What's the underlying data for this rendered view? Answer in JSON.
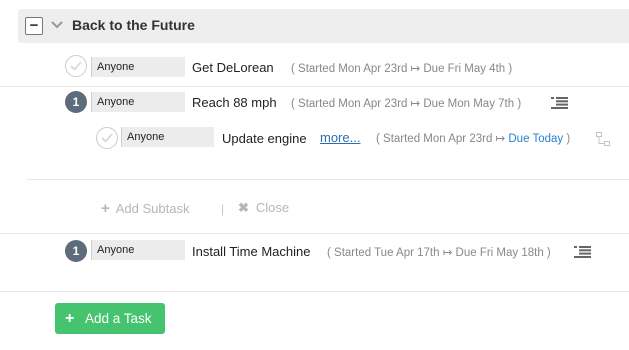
{
  "group": {
    "collapse_symbol": "−",
    "chevron_icon": "chevron-down-icon",
    "title": "Back to the Future"
  },
  "tasks": [
    {
      "status": "unchecked",
      "assignee": "Anyone",
      "name": "Get DeLorean",
      "dates": "( Started Mon Apr 23rd ↦ Due Fri May 4th )"
    },
    {
      "status_count": "1",
      "assignee": "Anyone",
      "name": "Reach 88 mph",
      "dates": "( Started Mon Apr 23rd ↦ Due Mon May 7th )",
      "icon": "description-icon",
      "subtasks": [
        {
          "status": "unchecked",
          "assignee": "Anyone",
          "name": "Update engine",
          "more_link": "more...",
          "dates_prefix": "( Started Mon Apr 23rd ↦ ",
          "due": "Due Today",
          "dates_suffix": " )",
          "icon": "subtask-icon"
        }
      ],
      "add_subtask_label": "Add Subtask",
      "separator": "|",
      "close_label": "Close"
    },
    {
      "status_count": "1",
      "assignee": "Anyone",
      "name": "Install Time Machine",
      "dates": "( Started Tue Apr 17th ↦ Due Fri May 18th )",
      "icon": "description-icon"
    }
  ],
  "add_task_button": {
    "icon": "+",
    "label": "Add a Task",
    "color": "#45c36e"
  },
  "colors": {
    "due_today": "#2a7fd4",
    "badge": "#5d6b7a",
    "header_bg": "#eeeeef"
  }
}
